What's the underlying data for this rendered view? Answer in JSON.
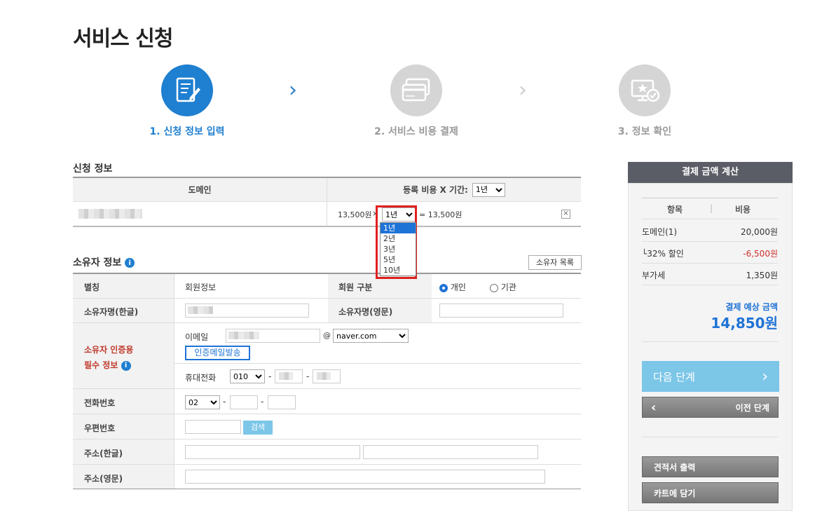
{
  "page_title": "서비스 신청",
  "steps": [
    {
      "label": "1. 신청 정보 입력",
      "active": true,
      "icon": "form-edit-icon"
    },
    {
      "label": "2. 서비스 비용 결제",
      "active": false,
      "icon": "credit-card-icon"
    },
    {
      "label": "3. 정보 확인",
      "active": false,
      "icon": "monitor-star-check-icon"
    }
  ],
  "application": {
    "section_title": "신청 정보",
    "col_domain": "도메인",
    "col_fee_label": "등록 비용 X 기간:",
    "header_period": "1년",
    "row": {
      "price": "13,500원",
      "mult": "×",
      "period": "1년",
      "total": "= 13,500원",
      "remove": "×"
    },
    "period_options": [
      "1년",
      "2년",
      "3년",
      "5년",
      "10년"
    ],
    "period_selected": "1년"
  },
  "owner": {
    "section_title": "소유자 정보",
    "list_button": "소유자 목록",
    "alias_label": "별칭",
    "alias_value": "회원정보",
    "member_type_label": "회원 구분",
    "member_types": [
      "개인",
      "기관"
    ],
    "member_type_selected": "개인",
    "name_kr_label": "소유자명(한글)",
    "name_en_label": "소유자명(영문)",
    "auth_label_1": "소유자 인증용",
    "auth_label_2": "필수 정보",
    "email_label": "이메일",
    "email_at": "@",
    "email_domain": "naver.com",
    "send_mail_button": "인증메일발송",
    "mobile_label": "휴대전화",
    "mobile_prefix": "010",
    "dash": "-",
    "phone_label": "전화번호",
    "phone_prefix": "02",
    "zip_label": "우편번호",
    "search_button": "검색",
    "addr_kr_label": "주소(한글)",
    "addr_en_label": "주소(영문)"
  },
  "summary": {
    "header": "결제 금액 계산",
    "col_item": "항목",
    "col_cost": "비용",
    "rows": [
      {
        "item": "도메인(1)",
        "cost": "20,000원",
        "negative": false
      },
      {
        "item": "└32% 할인",
        "cost": "-6,500원",
        "negative": true
      },
      {
        "item": "부가세",
        "cost": "1,350원",
        "negative": false
      }
    ],
    "expected_label": "결제 예상 금액",
    "expected_value": "14,850원",
    "next_button": "다음 단계",
    "next_arrow": "›",
    "prev_button": "이전 단계",
    "prev_arrow": "‹",
    "quote_button": "견적서 출력",
    "cart_button": "카트에 담기"
  },
  "colors": {
    "accent": "#1e73d6",
    "discount": "#d0312d",
    "required": "#c0392b",
    "highlight_box": "#e0201f"
  }
}
